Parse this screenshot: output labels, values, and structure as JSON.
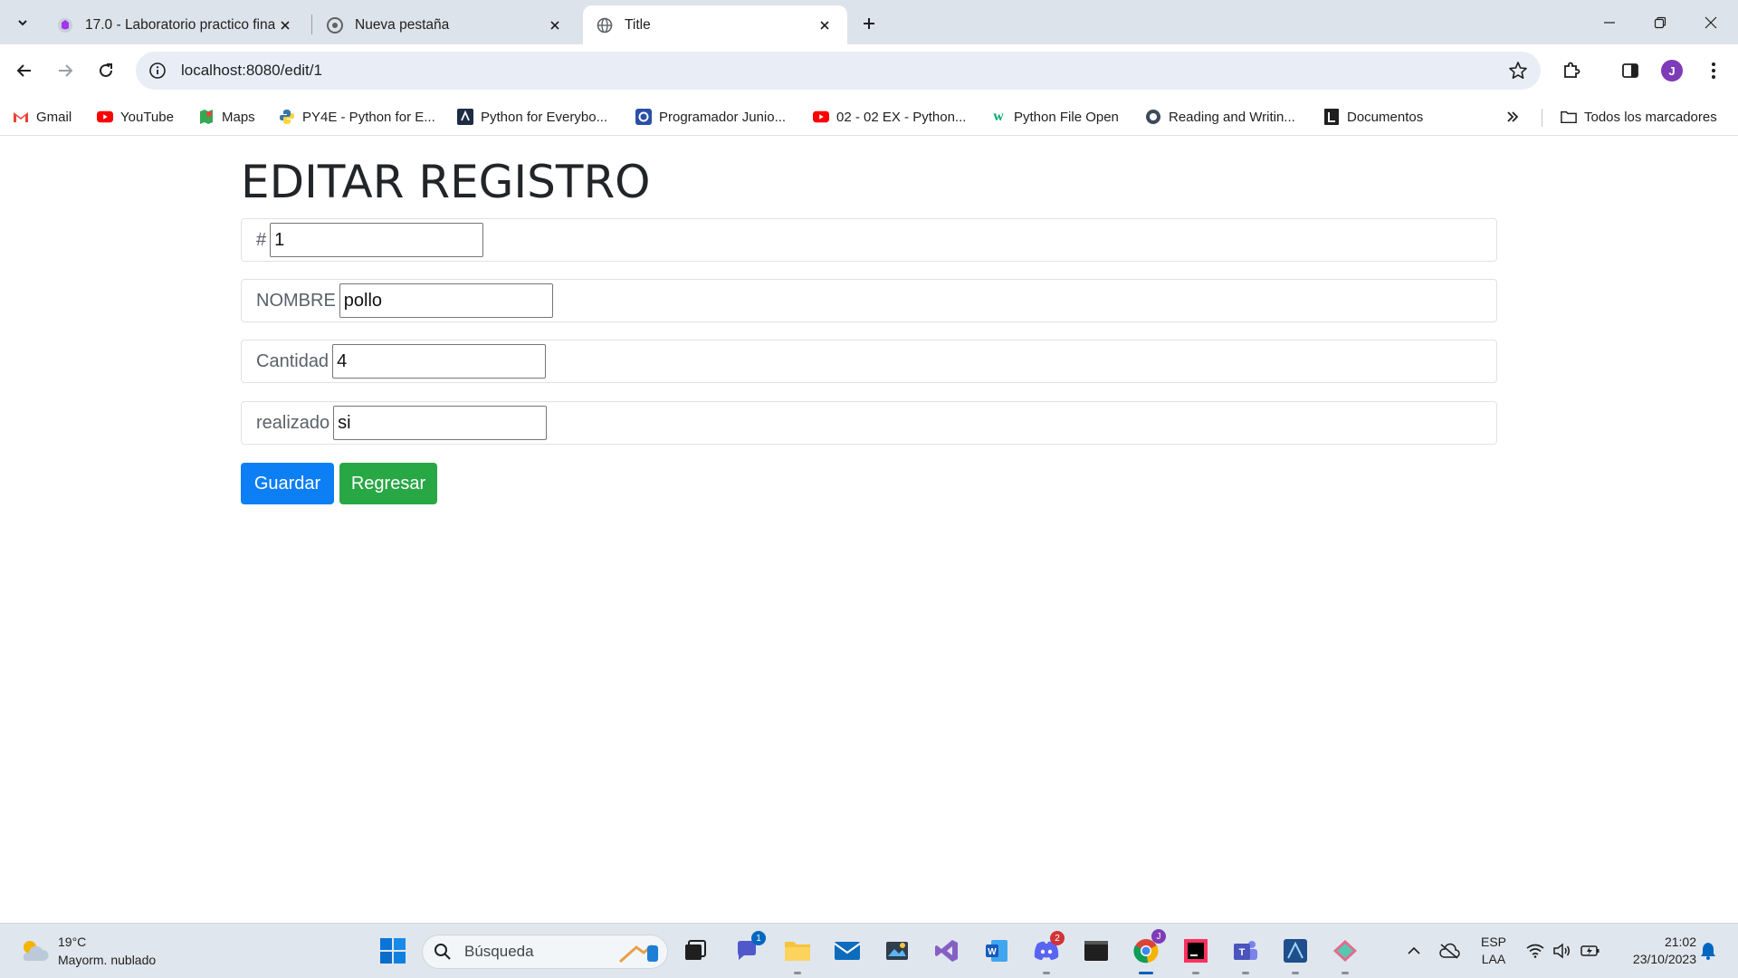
{
  "browser": {
    "tabs": [
      {
        "title": "17.0 - Laboratorio practico fina",
        "favicon": "udemy-icon"
      },
      {
        "title": "Nueva pestaña",
        "favicon": "chrome-icon"
      },
      {
        "title": "Title",
        "favicon": "globe-icon"
      }
    ],
    "active_tab": 2,
    "url": "localhost:8080/edit/1",
    "bookmarks": [
      {
        "label": "Gmail",
        "icon": "gmail-icon"
      },
      {
        "label": "YouTube",
        "icon": "youtube-icon"
      },
      {
        "label": "Maps",
        "icon": "maps-icon"
      },
      {
        "label": "PY4E - Python for E...",
        "icon": "python-icon"
      },
      {
        "label": "Python for Everybo...",
        "icon": "coursera-icon"
      },
      {
        "label": "Programador Junio...",
        "icon": "cert-icon"
      },
      {
        "label": "02 - 02 EX - Python...",
        "icon": "youtube-icon"
      },
      {
        "label": "Python File Open",
        "icon": "w3schools-icon"
      },
      {
        "label": "Reading and Writin...",
        "icon": "python-icon"
      },
      {
        "label": "Documentos",
        "icon": "docs-icon"
      }
    ],
    "all_bookmarks": "Todos los marcadores",
    "profile_initial": "J"
  },
  "form": {
    "title": "EDITAR REGISTRO",
    "fields": [
      {
        "label": "#",
        "value": "1"
      },
      {
        "label": "NOMBRE",
        "value": "pollo"
      },
      {
        "label": "Cantidad",
        "value": "4"
      },
      {
        "label": "realizado",
        "value": "si"
      }
    ],
    "save_label": "Guardar",
    "back_label": "Regresar"
  },
  "colors": {
    "primary": "#0d7ff5",
    "success": "#28a745"
  },
  "taskbar": {
    "weather_temp": "19°C",
    "weather_desc": "Mayorm. nublado",
    "search_placeholder": "Búsqueda",
    "teams_badge": "1",
    "discord_badge": "2",
    "lang_top": "ESP",
    "lang_bottom": "LAA",
    "time": "21:02",
    "date": "23/10/2023"
  }
}
